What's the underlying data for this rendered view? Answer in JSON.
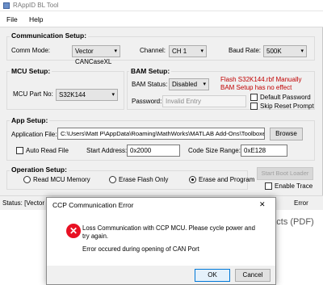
{
  "window": {
    "title": "RAppID BL Tool"
  },
  "menu": {
    "file": "File",
    "help": "Help"
  },
  "comm": {
    "title": "Communication Setup:",
    "mode_label": "Comm Mode:",
    "mode_value": "Vector CANCaseXL",
    "channel_label": "Channel:",
    "channel_value": "CH 1",
    "baud_label": "Baud Rate:",
    "baud_value": "500K"
  },
  "mcu": {
    "title": "MCU Setup:",
    "part_label": "MCU Part No:",
    "part_value": "S32K144"
  },
  "bam": {
    "title": "BAM Setup:",
    "status_label": "BAM Status:",
    "status_value": "Disabled",
    "password_label": "Password:",
    "password_value": "Invalid Entry",
    "note1": "Flash S32K144.rbf Manually",
    "note2": "BAM Setup has no effect",
    "default_password": "Default Password",
    "skip_reset": "Skip Reset Prompt"
  },
  "app": {
    "title": "App Setup:",
    "file_label": "Application File:",
    "file_value": "C:\\Users\\Matt P\\AppData\\Roaming\\MathWorks\\MATLAB Add-Ons\\Toolboxe",
    "browse": "Browse",
    "auto_read": "Auto Read File",
    "start_label": "Start Address:",
    "start_value": "0x2000",
    "size_label": "Code Size Range:",
    "size_value": "0xE128"
  },
  "op": {
    "title": "Operation Setup:",
    "read": "Read MCU Memory",
    "erase_only": "Erase Flash Only",
    "erase_program": "Erase and Program",
    "start_boot": "Start Boot Loader",
    "enable_trace": "Enable Trace"
  },
  "status": {
    "text": "Status: [Vector C",
    "error": "Error"
  },
  "background": {
    "line1": "f facts (PDF)",
    "line2": "F)"
  },
  "dialog": {
    "title": "CCP Communication Error",
    "msg1": "Loss Communication with CCP MCU. Please cycle power and",
    "msg2": "try again.",
    "msg3": "Error occured during opening of CAN Port",
    "ok": "OK",
    "cancel": "Cancel",
    "close": "✕"
  },
  "colors": {
    "note": "#c00000",
    "error_icon": "#e81123",
    "selected_border": "#0078d7"
  }
}
